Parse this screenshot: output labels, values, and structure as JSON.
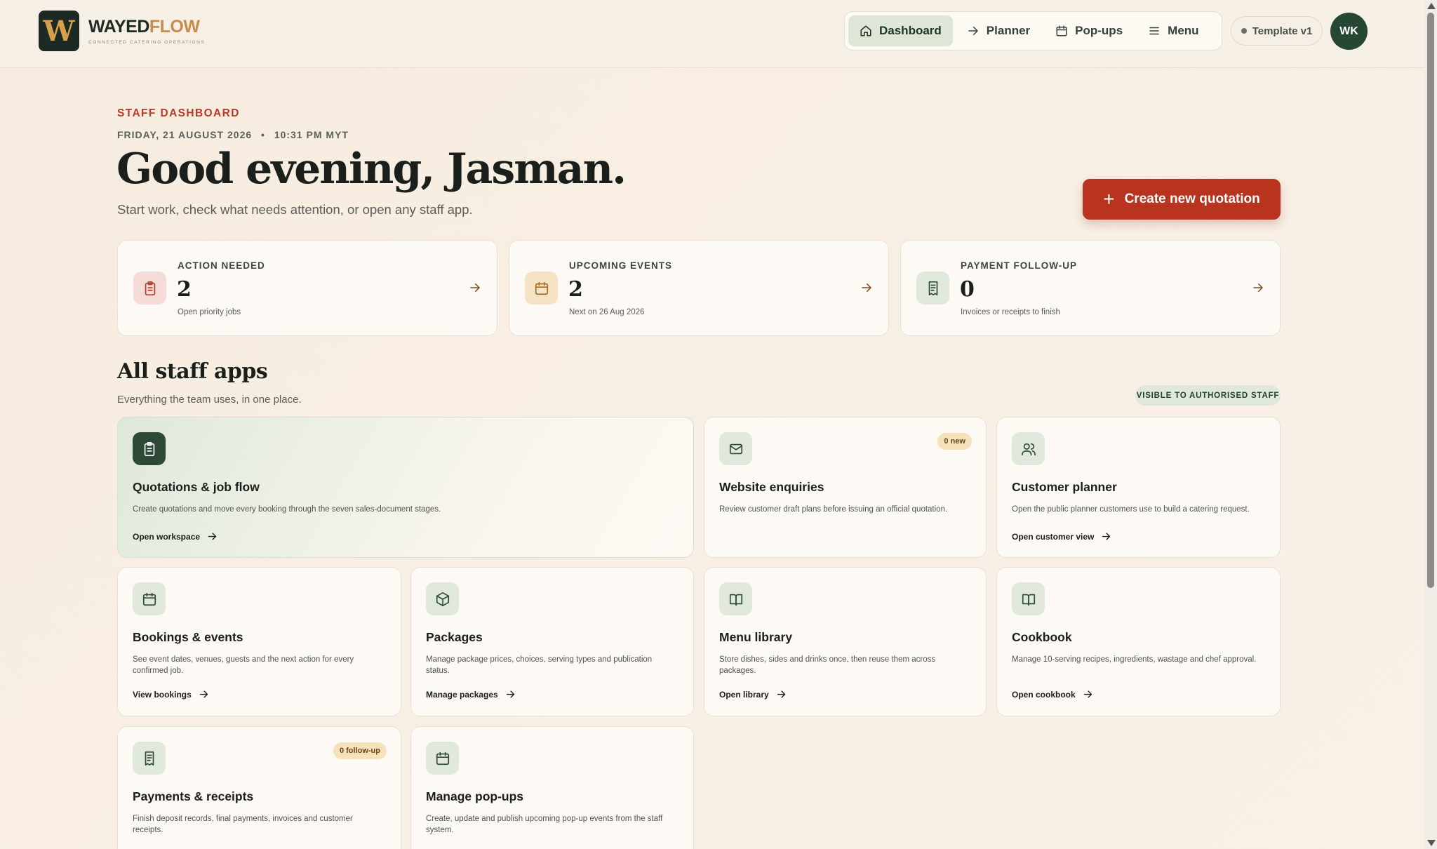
{
  "header": {
    "logo_letter": "W",
    "brand_primary": "WAYED",
    "brand_secondary": "FLOW",
    "brand_tagline": "CONNECTED CATERING OPERATIONS",
    "nav": [
      {
        "label": "Dashboard",
        "icon": "home-icon",
        "active": true
      },
      {
        "label": "Planner",
        "icon": "arrow-right-icon",
        "active": false
      },
      {
        "label": "Pop-ups",
        "icon": "calendar-icon",
        "active": false
      },
      {
        "label": "Menu",
        "icon": "menu-icon",
        "active": false
      }
    ],
    "template_label": "Template v1",
    "avatar_initials": "WK"
  },
  "hero": {
    "eyebrow": "STAFF DASHBOARD",
    "date": "FRIDAY, 21 AUGUST 2026",
    "separator": "•",
    "time": "10:31 PM MYT",
    "greeting": "Good evening, Jasman.",
    "subtitle": "Start work, check what needs attention, or open any staff app.",
    "cta_label": "Create new quotation"
  },
  "stats": [
    {
      "label": "ACTION NEEDED",
      "value": "2",
      "sub": "Open priority jobs",
      "icon": "clipboard-icon",
      "tint": "#f6dcd6",
      "icon_color": "#b83a26"
    },
    {
      "label": "UPCOMING EVENTS",
      "value": "2",
      "sub": "Next on 26 Aug 2026",
      "icon": "calendar-icon",
      "tint": "#f6e3c6",
      "icon_color": "#a86a1f"
    },
    {
      "label": "PAYMENT FOLLOW-UP",
      "value": "0",
      "sub": "Invoices or receipts to finish",
      "icon": "receipt-icon",
      "tint": "#e1e8dc",
      "icon_color": "#2c4a37"
    }
  ],
  "apps_section": {
    "title": "All staff apps",
    "subtitle": "Everything the team uses, in one place.",
    "badge": "VISIBLE TO AUTHORISED STAFF"
  },
  "apps": [
    {
      "title": "Quotations & job flow",
      "desc": "Create quotations and move every booking through the seven sales-document stages.",
      "link": "Open workspace",
      "icon": "clipboard-icon",
      "badge": ""
    },
    {
      "title": "Website enquiries",
      "desc": "Review customer draft plans before issuing an official quotation.",
      "link": "",
      "icon": "mail-icon",
      "badge": "0 new"
    },
    {
      "title": "Customer planner",
      "desc": "Open the public planner customers use to build a catering request.",
      "link": "Open customer view",
      "icon": "users-icon",
      "badge": ""
    },
    {
      "title": "Bookings & events",
      "desc": "See event dates, venues, guests and the next action for every confirmed job.",
      "link": "View bookings",
      "icon": "calendar-icon",
      "badge": ""
    },
    {
      "title": "Packages",
      "desc": "Manage package prices, choices, serving types and publication status.",
      "link": "Manage packages",
      "icon": "box-icon",
      "badge": ""
    },
    {
      "title": "Menu library",
      "desc": "Store dishes, sides and drinks once, then reuse them across packages.",
      "link": "Open library",
      "icon": "book-icon",
      "badge": ""
    },
    {
      "title": "Cookbook",
      "desc": "Manage 10-serving recipes, ingredients, wastage and chef approval.",
      "link": "Open cookbook",
      "icon": "book-icon",
      "badge": ""
    },
    {
      "title": "Payments & receipts",
      "desc": "Finish deposit records, final payments, invoices and customer receipts.",
      "link": "",
      "icon": "receipt-icon",
      "badge": "0 follow-up"
    },
    {
      "title": "Manage pop-ups",
      "desc": "Create, update and publish upcoming pop-up events from the staff system.",
      "link": "",
      "icon": "calendar-icon",
      "badge": ""
    }
  ]
}
